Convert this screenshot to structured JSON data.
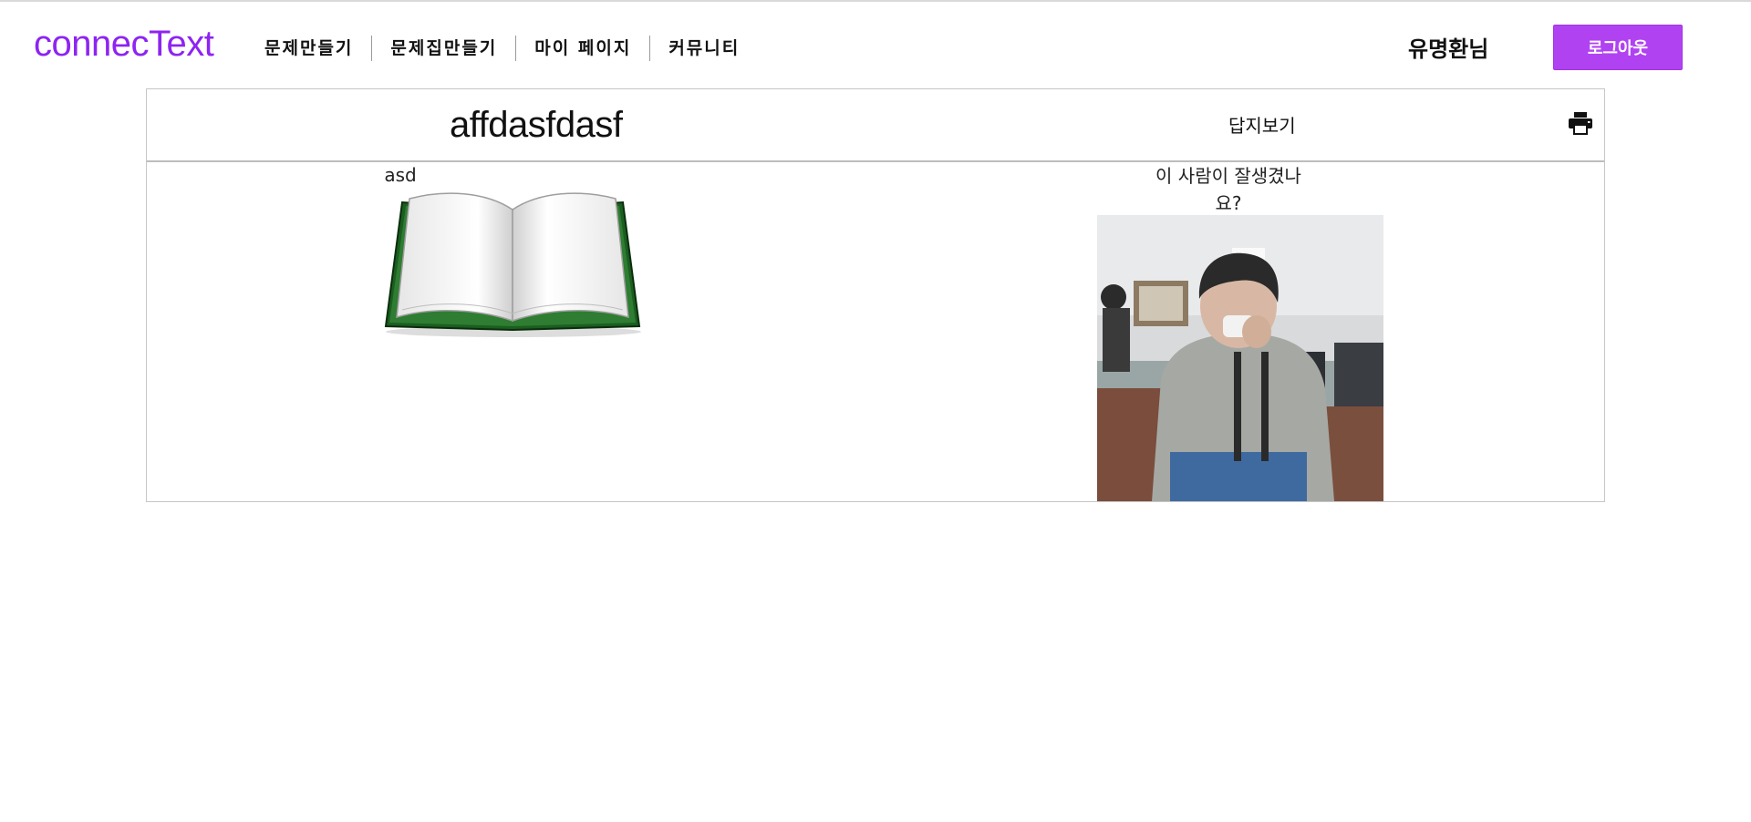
{
  "header": {
    "logo": "connecText",
    "nav": [
      {
        "label": "문제만들기"
      },
      {
        "label": "문제집만들기"
      },
      {
        "label": "마이 페이지"
      },
      {
        "label": "커뮤니티"
      }
    ],
    "username": "유명환님",
    "logout_label": "로그아웃"
  },
  "colors": {
    "brand": "#8d24f2",
    "logout_button": "#b142f2"
  },
  "document": {
    "title": "affdasfdasf",
    "answer_button": "답지보기",
    "print_icon": "print-icon"
  },
  "questions": [
    {
      "text": "asd",
      "image": "open-book-illustration"
    },
    {
      "text": "이 사람이 잘생겼나요?",
      "image": "person-photo-in-computer-lab"
    }
  ]
}
